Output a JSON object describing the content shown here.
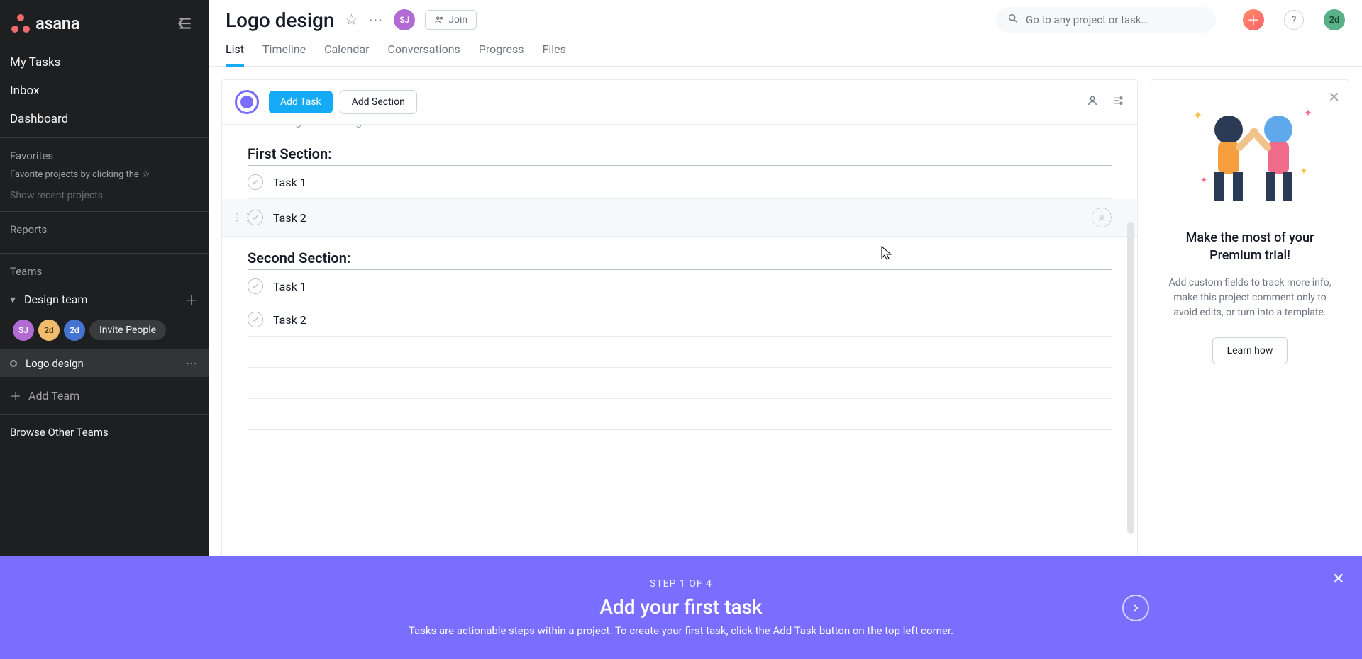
{
  "brand": "asana",
  "sidebar": {
    "nav": [
      "My Tasks",
      "Inbox",
      "Dashboard"
    ],
    "favorites_label": "Favorites",
    "favorites_hint": "Favorite projects by clicking the",
    "show_recent": "Show recent projects",
    "reports_label": "Reports",
    "teams_label": "Teams",
    "team_name": "Design team",
    "members": [
      "SJ",
      "2d",
      "2d"
    ],
    "invite": "Invite People",
    "project": "Logo design",
    "add_team": "Add Team",
    "browse": "Browse Other Teams"
  },
  "header": {
    "project_title": "Logo design",
    "owner_initials": "SJ",
    "join": "Join",
    "search_placeholder": "Go to any project or task...",
    "me_initials": "2d"
  },
  "tabs": [
    "List",
    "Timeline",
    "Calendar",
    "Conversations",
    "Progress",
    "Files"
  ],
  "active_tab": 0,
  "toolbar": {
    "add_task": "Add Task",
    "add_section": "Add Section"
  },
  "list": {
    "cutoff_task": "Design a draft logo",
    "sections": [
      {
        "title": "First Section:",
        "tasks": [
          "Task 1",
          "Task 2"
        ],
        "hover_idx": 1
      },
      {
        "title": "Second Section:",
        "tasks": [
          "Task 1",
          "Task 2"
        ],
        "hover_idx": -1
      }
    ]
  },
  "promo": {
    "title": "Make the most of your Premium trial!",
    "body": "Add custom fields to track more info, make this project comment only to avoid edits, or turn into a template.",
    "cta": "Learn how"
  },
  "banner": {
    "step": "STEP 1 OF 4",
    "title": "Add your first task",
    "body": "Tasks are actionable steps within a project. To create your first task, click the Add Task button on the top left corner."
  }
}
